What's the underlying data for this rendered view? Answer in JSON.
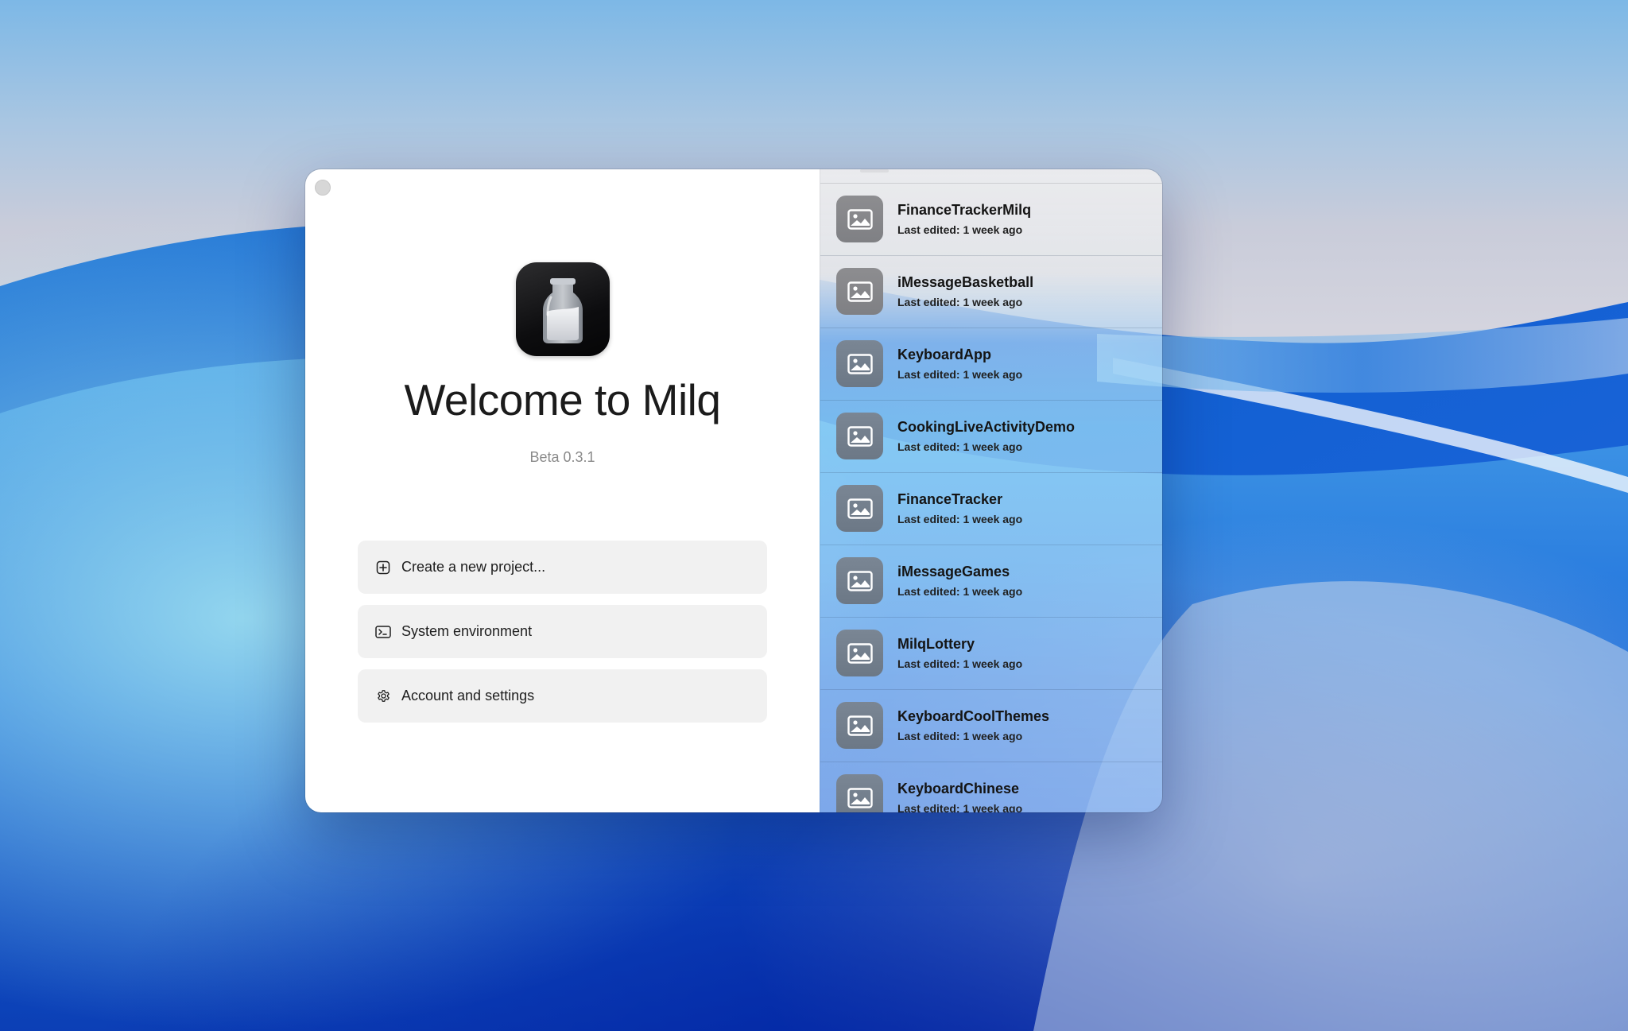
{
  "colors": {
    "accent_button_bg": "#f1f1f1",
    "title_text": "#1b1b1b",
    "version_text": "#8a8a8a",
    "thumbnail_bg": "#737f8d"
  },
  "welcome": {
    "title": "Welcome to Milq",
    "version": "Beta 0.3.1",
    "app_icon": "milk-bottle-icon"
  },
  "window": {
    "close_icon": "close-icon"
  },
  "actions": [
    {
      "label": "Create a new project...",
      "icon": "plus-square-icon"
    },
    {
      "label": "System environment",
      "icon": "terminal-icon"
    },
    {
      "label": "Account and settings",
      "icon": "gear-icon"
    }
  ],
  "projects": [
    {
      "name": "FinanceTrackerMilq",
      "last_edited": "Last edited: 1 week ago",
      "icon": "image-icon"
    },
    {
      "name": "iMessageBasketball",
      "last_edited": "Last edited: 1 week ago",
      "icon": "image-icon"
    },
    {
      "name": "KeyboardApp",
      "last_edited": "Last edited: 1 week ago",
      "icon": "image-icon"
    },
    {
      "name": "CookingLiveActivityDemo",
      "last_edited": "Last edited: 1 week ago",
      "icon": "image-icon"
    },
    {
      "name": "FinanceTracker",
      "last_edited": "Last edited: 1 week ago",
      "icon": "image-icon"
    },
    {
      "name": "iMessageGames",
      "last_edited": "Last edited: 1 week ago",
      "icon": "image-icon"
    },
    {
      "name": "MilqLottery",
      "last_edited": "Last edited: 1 week ago",
      "icon": "image-icon"
    },
    {
      "name": "KeyboardCoolThemes",
      "last_edited": "Last edited: 1 week ago",
      "icon": "image-icon"
    },
    {
      "name": "KeyboardChinese",
      "last_edited": "Last edited: 1 week ago",
      "icon": "image-icon"
    }
  ]
}
